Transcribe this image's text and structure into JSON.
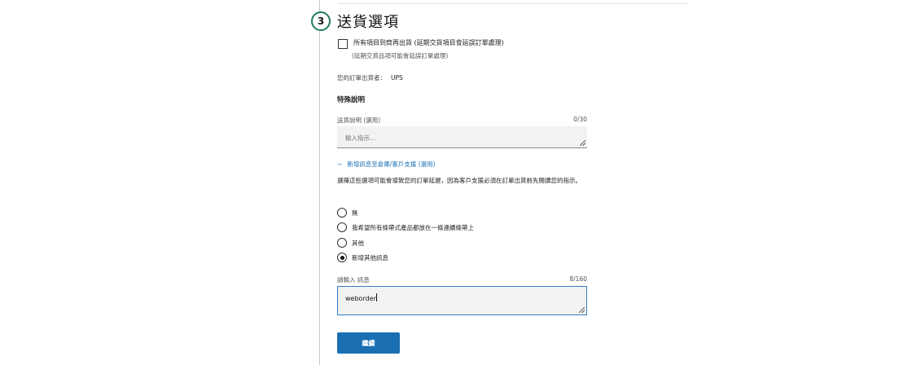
{
  "section": {
    "step_number": "3",
    "title": "送貨選項"
  },
  "ship_all": {
    "label": "所有項目到齊再出貨 (延期交貨項目會延誤訂單處理)",
    "sublabel": "(延期交貨品項可能會延誤訂單處理)",
    "checked": false
  },
  "shipper": {
    "label": "您的訂單出貨者：",
    "value": "UPS"
  },
  "special_instructions": {
    "heading": "特殊說明",
    "delivery_label": "送貨說明 (選用)",
    "delivery_counter": "0/30",
    "delivery_placeholder": "輸入指示...",
    "add_message_link": "新增訊息至倉庫/客戶支援 (選用)",
    "add_message_prefix": "−",
    "warning": "選擇這些選項可能會導致您的訂單延遲，因為客戶支援必須在訂單出貨前先閱讀您的指示。",
    "options": [
      {
        "label": "無",
        "selected": false
      },
      {
        "label": "我希望所有條帶式產品都放在一條連續條帶上",
        "selected": false
      },
      {
        "label": "其他",
        "selected": false
      },
      {
        "label": "新增其他訊息",
        "selected": true
      }
    ],
    "message_label": "請輸入 訊息",
    "message_counter": "8/160",
    "message_value": "weborder"
  },
  "actions": {
    "continue_label": "繼續"
  },
  "colors": {
    "accent": "#1a6fb3",
    "step_ring": "#1f7a62",
    "focus_border": "#2e7ec8"
  }
}
